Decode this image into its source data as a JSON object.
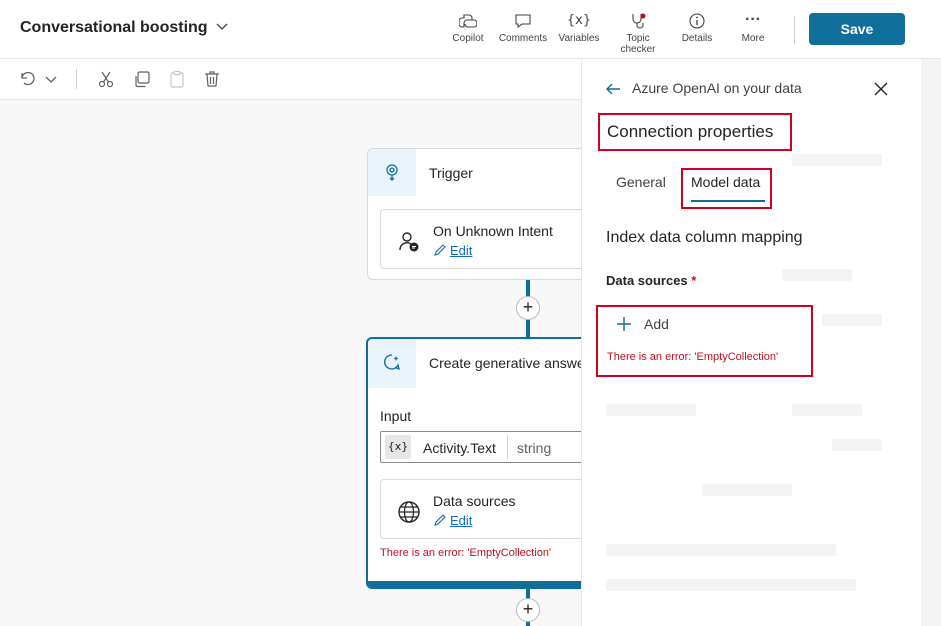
{
  "header": {
    "title": "Conversational boosting",
    "tools": [
      {
        "label": "Copilot",
        "icon": "copilot-icon"
      },
      {
        "label": "Comments",
        "icon": "comment-icon"
      },
      {
        "label": "Variables",
        "icon": "variables-icon"
      },
      {
        "label": "Topic checker",
        "icon": "stethoscope-icon"
      },
      {
        "label": "Details",
        "icon": "info-icon"
      },
      {
        "label": "More",
        "icon": "more-icon"
      }
    ],
    "save_label": "Save",
    "variables_glyph": "{x}",
    "more_glyph": "···"
  },
  "canvas": {
    "trigger": {
      "title": "Trigger",
      "card_title": "On Unknown Intent",
      "edit_label": "Edit"
    },
    "generative": {
      "title": "Create generative answers",
      "input_label": "Input",
      "var_badge": "{x}",
      "var_name": "Activity.Text",
      "var_type": "string",
      "datasource_title": "Data sources",
      "edit_label": "Edit",
      "error": "There is an error: 'EmptyCollection'"
    },
    "plus_glyph": "+"
  },
  "panel": {
    "back_title": "Azure OpenAI on your data",
    "heading": "Connection properties",
    "tabs": [
      {
        "label": "General",
        "selected": false
      },
      {
        "label": "Model data",
        "selected": true
      }
    ],
    "section_title": "Index data column mapping",
    "data_sources_label": "Data sources",
    "required_mark": "*",
    "add_label": "Add",
    "error": "There is an error: 'EmptyCollection'"
  },
  "colors": {
    "accent": "#0f6f9a",
    "error": "#c50f1f",
    "highlight": "#d0021b",
    "link": "#0f6cbd"
  }
}
